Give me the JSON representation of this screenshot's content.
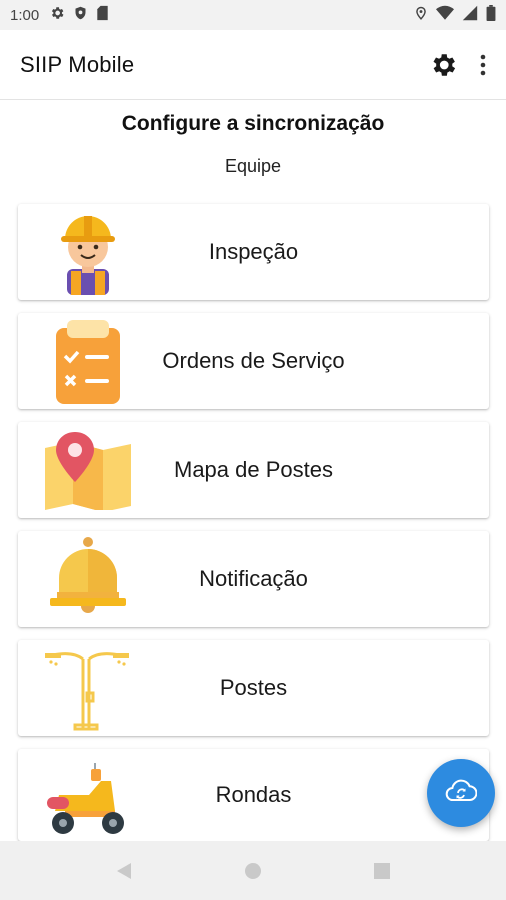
{
  "status_bar": {
    "time": "1:00",
    "left_icons": [
      "gear-icon",
      "shield-icon",
      "sd-card-icon"
    ],
    "right_icons": [
      "location-icon",
      "wifi-icon",
      "signal-icon",
      "battery-icon"
    ]
  },
  "app_bar": {
    "title": "SIIP Mobile",
    "actions": [
      "settings-gear-icon",
      "more-vert-icon"
    ]
  },
  "page": {
    "heading": "Configure a sincronização",
    "subheading": "Equipe"
  },
  "menu_items": [
    {
      "label": "Inspeção",
      "icon": "worker-helmet-icon"
    },
    {
      "label": "Ordens de Serviço",
      "icon": "clipboard-checklist-icon"
    },
    {
      "label": "Mapa de Postes",
      "icon": "map-pin-icon"
    },
    {
      "label": "Notificação",
      "icon": "bell-icon"
    },
    {
      "label": "Postes",
      "icon": "street-lamp-icon"
    },
    {
      "label": "Rondas",
      "icon": "scooter-icon"
    }
  ],
  "fab": {
    "icon": "cloud-sync-icon",
    "color": "#2d8be0"
  },
  "nav_bar": {
    "buttons": [
      "back-icon",
      "home-icon",
      "recents-icon"
    ]
  },
  "colors": {
    "accent": "#2d8be0",
    "orange": "#f7a13a",
    "yellow": "#f5c84c"
  }
}
